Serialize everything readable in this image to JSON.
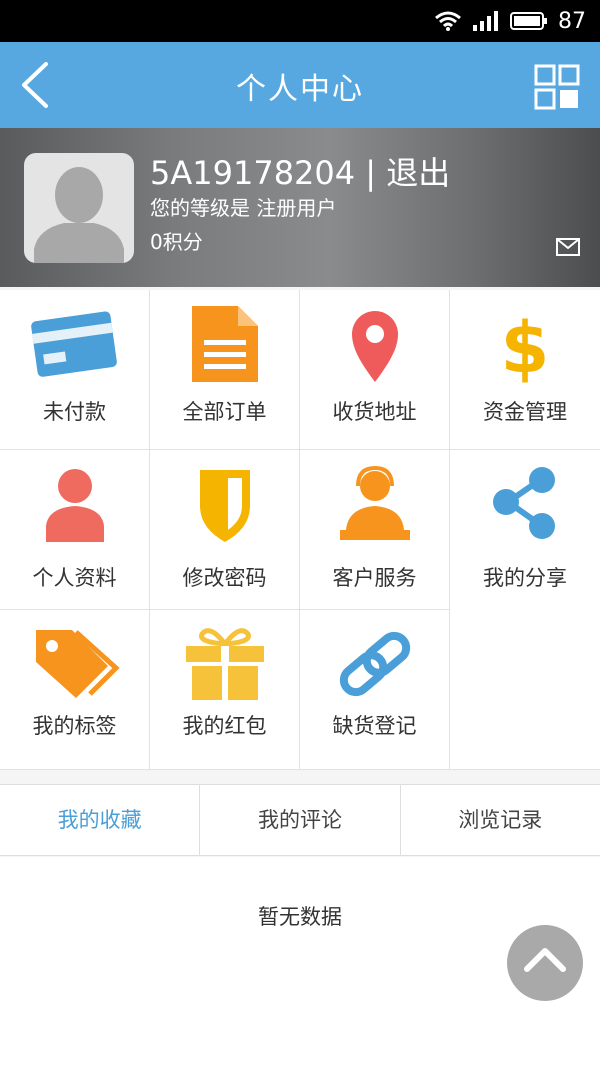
{
  "status": {
    "battery": "87"
  },
  "nav": {
    "title": "个人中心"
  },
  "profile": {
    "username": "5A19178204",
    "separator": "|",
    "logout": "退出",
    "level": "您的等级是 注册用户",
    "points": "0积分"
  },
  "menu": [
    {
      "label": "未付款",
      "icon": "credit-card-icon",
      "color": "#4a9fd8"
    },
    {
      "label": "全部订单",
      "icon": "document-icon",
      "color": "#f7941d"
    },
    {
      "label": "收货地址",
      "icon": "location-pin-icon",
      "color": "#ef5b5b"
    },
    {
      "label": "资金管理",
      "icon": "dollar-icon",
      "color": "#f5b400"
    },
    {
      "label": "个人资料",
      "icon": "user-icon",
      "color": "#ef6a5f"
    },
    {
      "label": "修改密码",
      "icon": "shield-icon",
      "color": "#f5b400"
    },
    {
      "label": "客户服务",
      "icon": "customer-service-icon",
      "color": "#f7941d"
    },
    {
      "label": "我的分享",
      "icon": "share-icon",
      "color": "#4a9fd8"
    },
    {
      "label": "我的标签",
      "icon": "tag-icon",
      "color": "#f7941d"
    },
    {
      "label": "我的红包",
      "icon": "gift-icon",
      "color": "#f5c23a"
    },
    {
      "label": "缺货登记",
      "icon": "link-icon",
      "color": "#4a9fd8"
    }
  ],
  "tabs": [
    {
      "label": "我的收藏",
      "active": true
    },
    {
      "label": "我的评论",
      "active": false
    },
    {
      "label": "浏览记录",
      "active": false
    }
  ],
  "content": {
    "empty_text": "暂无数据"
  },
  "colors": {
    "nav_bg": "#57a8e0",
    "accent": "#4a9fd8"
  }
}
